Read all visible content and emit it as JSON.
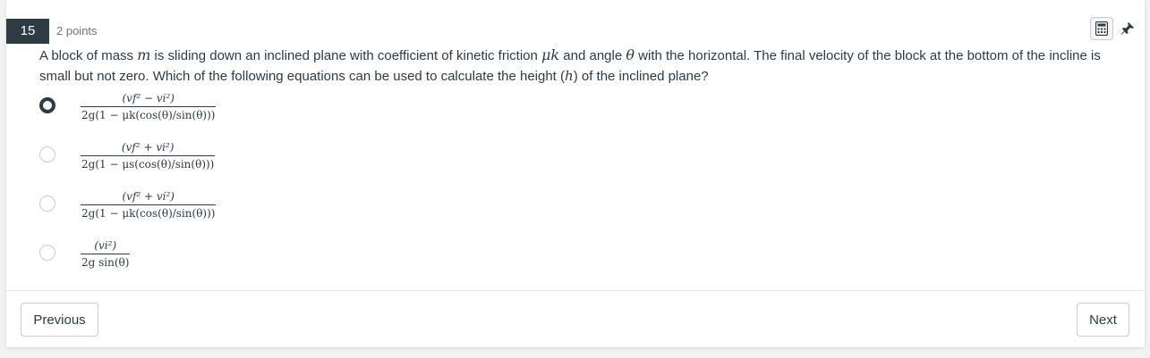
{
  "question": {
    "number": "15",
    "points": "2 points",
    "text_part1": "A block of mass ",
    "mass_symbol": "m",
    "text_part2": " is sliding down an inclined plane with coefficient of kinetic friction ",
    "friction_symbol": "μk",
    "text_part3": " and angle ",
    "angle_symbol": "θ",
    "text_part4": " with the horizontal. The final velocity of the block at the bottom of the incline is small but not zero. Which of the following equations can be used to calculate the height (",
    "height_symbol": "h",
    "text_part5": ") of the inclined plane?"
  },
  "toolbar": {
    "calculator_icon": "calculator-icon",
    "pin_icon": "pin-icon"
  },
  "choices": [
    {
      "selected": true,
      "numerator": "(vf² − vi²)",
      "denominator": "2g(1 − μk(cos(θ)/sin(θ)))"
    },
    {
      "selected": false,
      "numerator": "(vf² + vi²)",
      "denominator": "2g(1 − μs(cos(θ)/sin(θ)))"
    },
    {
      "selected": false,
      "numerator": "(vf² + vi²)",
      "denominator": "2g(1 − μk(cos(θ)/sin(θ)))"
    },
    {
      "selected": false,
      "numerator": "(vi²)",
      "denominator": "2g sin(θ)"
    }
  ],
  "navigation": {
    "previous_label": "Previous",
    "next_label": "Next"
  }
}
